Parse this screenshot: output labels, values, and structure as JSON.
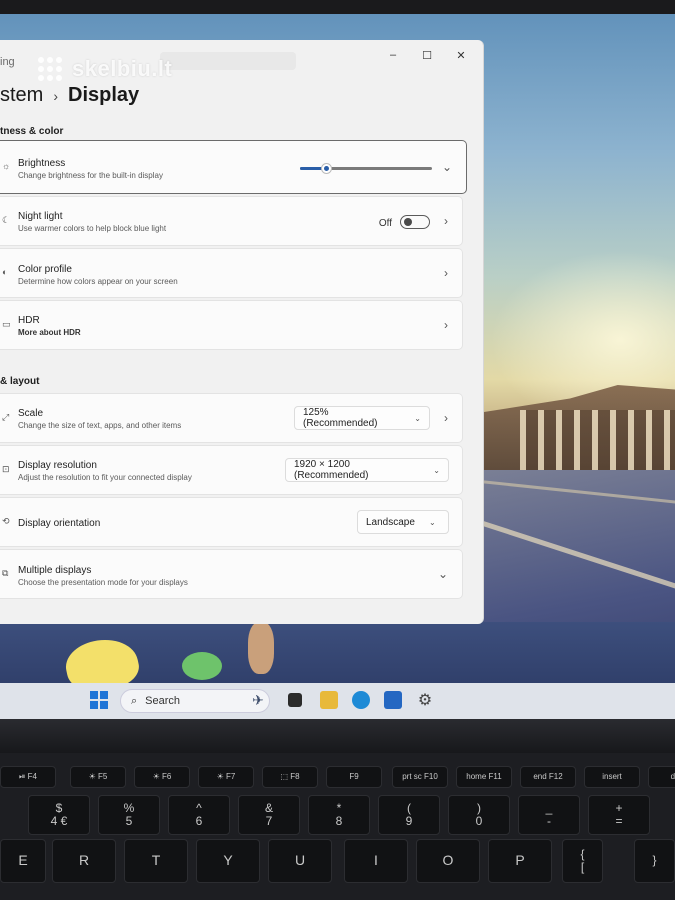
{
  "window": {
    "app_title_partial": "ing",
    "controls": {
      "minimize": "–",
      "maximize": "☐",
      "close": "✕"
    }
  },
  "watermark": {
    "text": "skelbiu.lt"
  },
  "breadcrumb": {
    "parent": "stem",
    "separator": "›",
    "current": "Display"
  },
  "sections": {
    "brightness_color": "tness & color",
    "scale_layout": "& layout"
  },
  "settings": {
    "brightness": {
      "title": "Brightness",
      "subtitle": "Change brightness for the built-in display",
      "value_fraction": 0.2,
      "expand_glyph": "⌄"
    },
    "night_light": {
      "title": "Night light",
      "subtitle": "Use warmer colors to help block blue light",
      "state_label": "Off",
      "enabled": false
    },
    "color_profile": {
      "title": "Color profile",
      "subtitle": "Determine how colors appear on your screen"
    },
    "hdr": {
      "title": "HDR",
      "subtitle": "More about HDR"
    },
    "scale": {
      "title": "Scale",
      "subtitle": "Change the size of text, apps, and other items",
      "value": "125% (Recommended)"
    },
    "resolution": {
      "title": "Display resolution",
      "subtitle": "Adjust the resolution to fit your connected display",
      "value": "1920 × 1200 (Recommended)"
    },
    "orientation": {
      "title": "Display orientation",
      "value": "Landscape"
    },
    "multiple_displays": {
      "title": "Multiple displays",
      "subtitle": "Choose the presentation mode for your displays"
    }
  },
  "glyphs": {
    "chevron_right": "›",
    "chevron_down": "⌄"
  },
  "taskbar": {
    "search_label": "Search",
    "icons": [
      "start-icon",
      "search-icon",
      "plane-widget-icon",
      "task-view-icon",
      "file-explorer-icon",
      "edge-icon",
      "store-icon",
      "settings-icon"
    ]
  },
  "keyboard": {
    "function_keys": [
      "⏯",
      "☀",
      "☀",
      "☀",
      "⬚",
      "",
      "prt sc",
      "home",
      "end",
      "insert",
      "del"
    ],
    "function_sublabels": [
      "F4",
      "F5",
      "F6",
      "F7",
      "F8",
      "F9",
      "F10",
      "F11",
      "F12",
      "",
      ""
    ],
    "number_keys": [
      {
        "top": "$",
        "bottom": "4 €"
      },
      {
        "top": "%",
        "bottom": "5"
      },
      {
        "top": "^",
        "bottom": "6"
      },
      {
        "top": "&",
        "bottom": "7"
      },
      {
        "top": "*",
        "bottom": "8"
      },
      {
        "top": "(",
        "bottom": "9"
      },
      {
        "top": ")",
        "bottom": "0"
      },
      {
        "top": "_",
        "bottom": "-"
      },
      {
        "top": "+",
        "bottom": "="
      }
    ],
    "letter_keys": [
      "E",
      "R",
      "T",
      "Y",
      "U",
      "I",
      "O",
      "P"
    ],
    "bracket_key": {
      "top": "{",
      "bottom": "["
    },
    "bracket_key2": {
      "top": "}",
      "bottom": ""
    }
  },
  "colors": {
    "accent": "#2a5ea8",
    "window_bg": "#f1f1f1",
    "card_bg": "#fbfbfb",
    "taskbar_bg": "#dfe3ea",
    "windows_logo": "#1f74d6"
  }
}
